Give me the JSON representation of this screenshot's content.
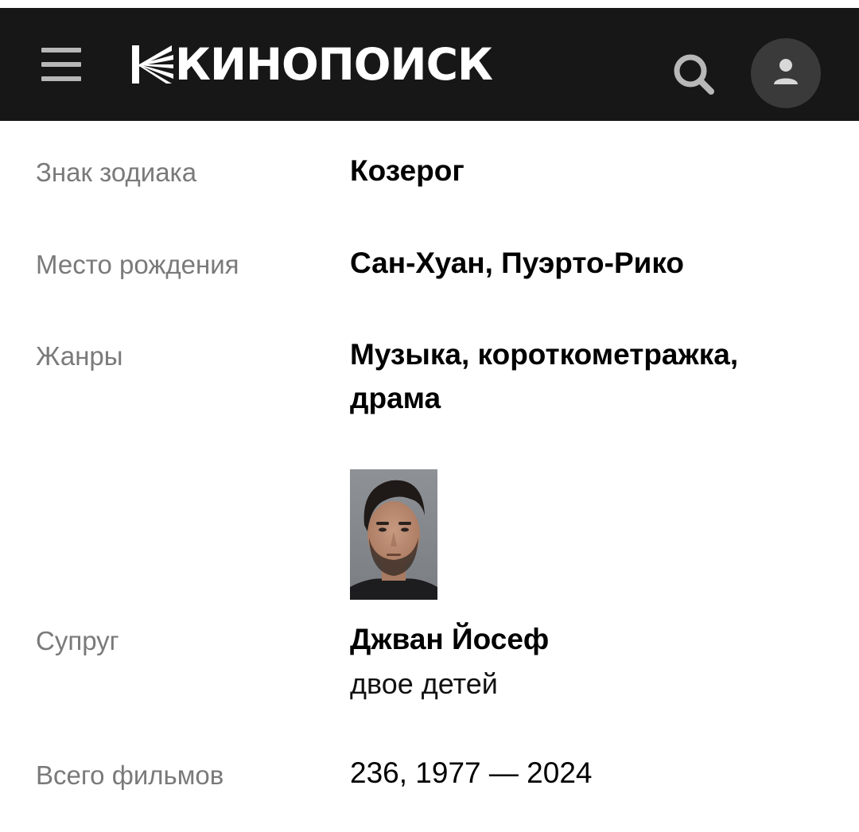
{
  "header": {
    "logo_text": "КИНОПОИСК",
    "menu_icon": "hamburger-menu-icon",
    "search_icon": "search-icon",
    "profile_icon": "user-icon",
    "colors": {
      "background": "#171717",
      "icon": "#b8b8b8",
      "avatar_bg": "#3a3a3a"
    }
  },
  "details": {
    "zodiac": {
      "label": "Знак зодиака",
      "value": "Козерог"
    },
    "birthplace": {
      "label": "Место рождения",
      "value": "Сан-Хуан, Пуэрто-Рико"
    },
    "genres": {
      "label": "Жанры",
      "line1": "Музыка, короткометражка,",
      "line2": "драма"
    },
    "spouse": {
      "label": "Супруг",
      "name": "Джван Йосеф",
      "note": "двое детей"
    },
    "films": {
      "label": "Всего фильмов",
      "value": "236, 1977 — 2024"
    }
  }
}
